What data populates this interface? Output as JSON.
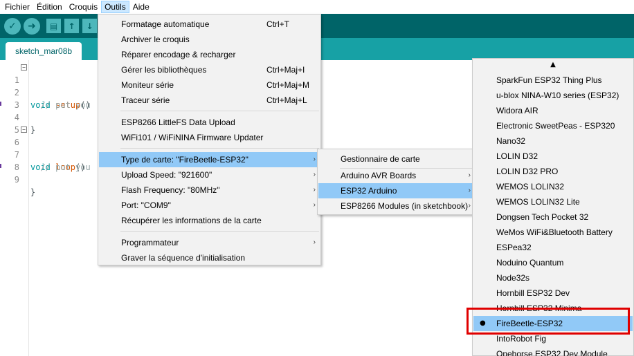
{
  "menubar": {
    "items": [
      "Fichier",
      "Édition",
      "Croquis",
      "Outils",
      "Aide"
    ],
    "active": "Outils"
  },
  "toolbar": {
    "verify_icon": "check-icon",
    "upload_icon": "arrow-right-icon",
    "new_icon": "new-file-icon",
    "open_icon": "arrow-up-icon",
    "save_icon": "arrow-down-icon"
  },
  "tab": {
    "label": "sketch_mar08b"
  },
  "editor": {
    "lines": [
      {
        "num": "1",
        "fold": "⊟",
        "kw": "void ",
        "fn": "setup",
        "rest": "()"
      },
      {
        "num": "2",
        "comment": "  // put you"
      },
      {
        "num": "3"
      },
      {
        "num": "4",
        "plain": "}"
      },
      {
        "num": "5"
      },
      {
        "num": "6",
        "fold": "⊟",
        "kw": "void ",
        "fn": "loop",
        "rest": "()"
      },
      {
        "num": "7",
        "comment": "  // put you"
      },
      {
        "num": "8"
      },
      {
        "num": "9",
        "plain": "}"
      }
    ]
  },
  "outils_menu": {
    "items": [
      {
        "label": "Formatage automatique",
        "shortcut": "Ctrl+T"
      },
      {
        "label": "Archiver le croquis",
        "shortcut": ""
      },
      {
        "label": "Réparer encodage & recharger",
        "shortcut": ""
      },
      {
        "label": "Gérer les bibliothèques",
        "shortcut": "Ctrl+Maj+I"
      },
      {
        "label": "Moniteur série",
        "shortcut": "Ctrl+Maj+M"
      },
      {
        "label": "Traceur série",
        "shortcut": "Ctrl+Maj+L"
      },
      {
        "label": "ESP8266 LittleFS Data Upload",
        "shortcut": ""
      },
      {
        "label": "WiFi101 / WiFiNINA Firmware Updater",
        "shortcut": ""
      },
      {
        "label": "Type de carte: \"FireBeetle-ESP32\"",
        "shortcut": ""
      },
      {
        "label": "Upload Speed: \"921600\"",
        "shortcut": ""
      },
      {
        "label": "Flash Frequency: \"80MHz\"",
        "shortcut": ""
      },
      {
        "label": "Port: \"COM9\"",
        "shortcut": ""
      },
      {
        "label": "Récupérer les informations de la carte",
        "shortcut": ""
      },
      {
        "label": "Programmateur",
        "shortcut": ""
      },
      {
        "label": "Graver la séquence d'initialisation",
        "shortcut": ""
      }
    ],
    "submenu_arrow": "›"
  },
  "board_menu": {
    "items": [
      "Gestionnaire de carte",
      "Arduino AVR Boards",
      "ESP32 Arduino",
      "ESP8266 Modules (in sketchbook)"
    ]
  },
  "esp32_menu": {
    "scroll_up": "▲",
    "selected_bullet": "●",
    "items": [
      "SparkFun ESP32 Thing Plus",
      "u-blox NINA-W10 series (ESP32)",
      "Widora AIR",
      "Electronic SweetPeas - ESP320",
      "Nano32",
      "LOLIN D32",
      "LOLIN D32 PRO",
      "WEMOS LOLIN32",
      "WEMOS LOLIN32 Lite",
      "Dongsen Tech Pocket 32",
      "WeMos WiFi&Bluetooth Battery",
      "ESPea32",
      "Noduino Quantum",
      "Node32s",
      "Hornbill ESP32 Dev",
      "Hornbill ESP32 Minima",
      "FireBeetle-ESP32",
      "IntoRobot Fig",
      "Onehorse ESP32 Dev Module"
    ],
    "selected": "FireBeetle-ESP32"
  },
  "colors": {
    "toolbar": "#006468",
    "tabstrip": "#17a1a5",
    "highlight": "#91c9f7",
    "annotation": "#e00000"
  }
}
